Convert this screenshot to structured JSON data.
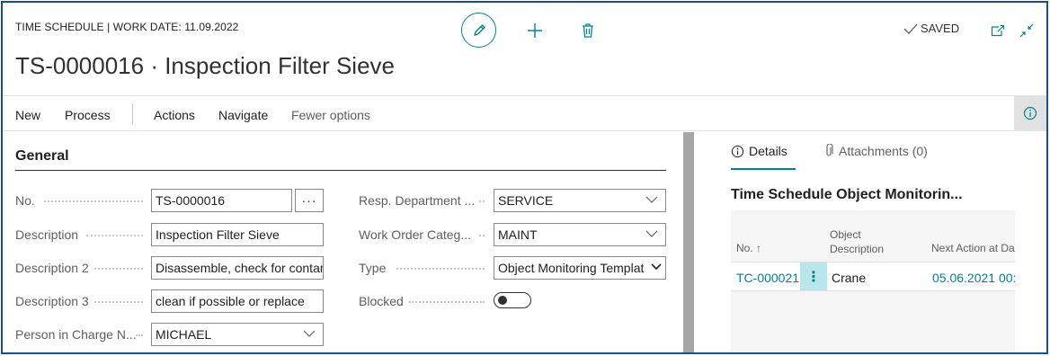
{
  "header": {
    "caption": "TIME SCHEDULE | WORK DATE: 11.09.2022",
    "title": "TS-0000016 · Inspection Filter Sieve",
    "status": "SAVED",
    "icons": [
      "edit-icon",
      "add-icon",
      "delete-icon",
      "checkmark-icon",
      "open-new-window-icon",
      "collapse-icon"
    ]
  },
  "actionbar": {
    "new": "New",
    "process": "Process",
    "actions": "Actions",
    "navigate": "Navigate",
    "fewer_options": "Fewer options"
  },
  "general": {
    "section_title": "General",
    "left_fields": [
      {
        "label": "No.",
        "value": "TS-0000016",
        "assist": "···"
      },
      {
        "label": "Description",
        "value": "Inspection Filter Sieve"
      },
      {
        "label": "Description 2",
        "value": "Disassemble, check for contan"
      },
      {
        "label": "Description 3",
        "value": "clean if possible or replace"
      },
      {
        "label": "Person in Charge N...",
        "value": "MICHAEL"
      }
    ],
    "right_fields": [
      {
        "label": "Resp. Department ...",
        "value": "SERVICE"
      },
      {
        "label": "Work Order Categ...",
        "value": "MAINT"
      },
      {
        "label": "Type",
        "value": "Object Monitoring Templat"
      },
      {
        "label": "Blocked",
        "value": false
      }
    ]
  },
  "factbox": {
    "tabs": {
      "details": "Details",
      "attachments": "Attachments (0)"
    },
    "title": "Time Schedule Object Monitorin...",
    "columns": {
      "no": "No. ↑",
      "object_desc_1": "Object",
      "object_desc_2": "Description",
      "next_action": "Next Action at Da"
    },
    "rows": [
      {
        "no": "TC-000021",
        "object": "Crane",
        "next_action": "05.06.2021 00:0"
      }
    ]
  },
  "colors": {
    "accent": "#00838f",
    "frame": "#1a4f8a",
    "row_menu": "#b8e6ea"
  }
}
